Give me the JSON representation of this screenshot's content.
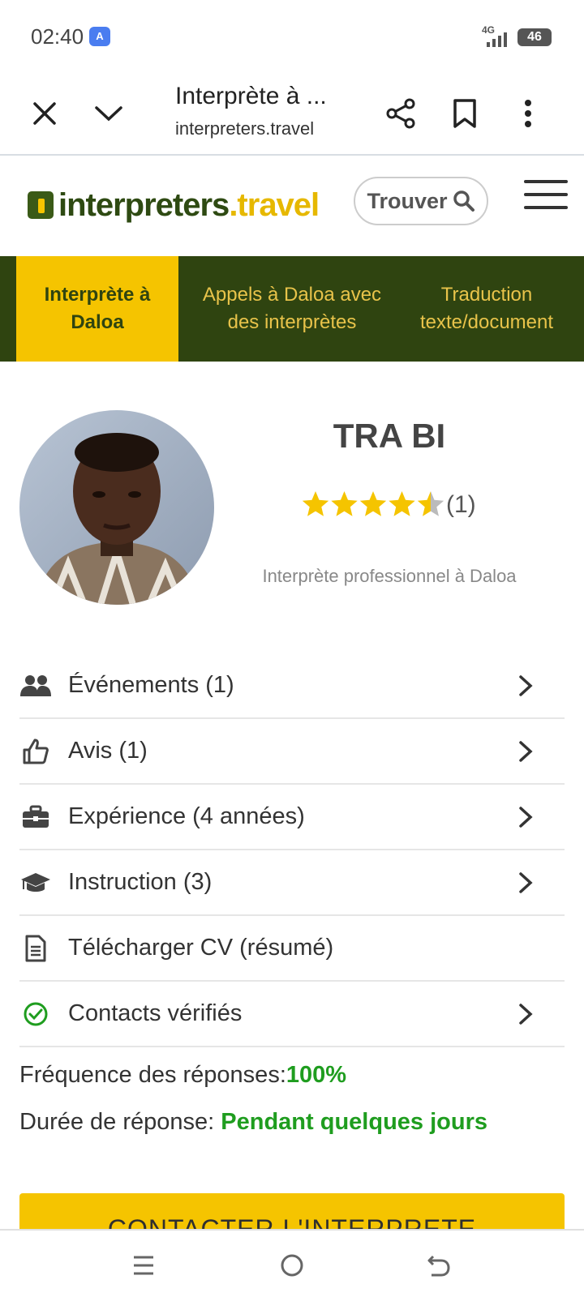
{
  "status_bar": {
    "time": "02:40",
    "translate_badge": "A",
    "network": "4G",
    "battery": "46"
  },
  "browser": {
    "tab_title": "Interprète à ...",
    "url": "interpreters.travel",
    "icons": [
      "close-icon",
      "chevron-down-icon",
      "share-icon",
      "bookmark-icon",
      "more-vert-icon"
    ]
  },
  "site": {
    "logo_main": "interpreters",
    "logo_tld": ".travel",
    "find_label": "Trouver"
  },
  "tabs": [
    {
      "label": "Interprète à Daloa",
      "active": true
    },
    {
      "label": "Appels à Daloa avec des interprètes",
      "active": false
    },
    {
      "label": "Traduction texte/document",
      "active": false
    }
  ],
  "profile": {
    "name": "TRA BI",
    "rating": 4.5,
    "rating_max": 5,
    "rating_count": "(1)",
    "subtitle": "Interprète professionnel à Daloa"
  },
  "menu": [
    {
      "icon": "users-icon",
      "label": "Événements (1)",
      "chevron": true
    },
    {
      "icon": "thumbs-up-icon",
      "label": "Avis (1)",
      "chevron": true
    },
    {
      "icon": "briefcase-icon",
      "label": "Expérience (4 années)",
      "chevron": true
    },
    {
      "icon": "graduation-cap-icon",
      "label": "Instruction (3)",
      "chevron": true
    },
    {
      "icon": "document-icon",
      "label": "Télécharger CV (résumé)",
      "chevron": false
    },
    {
      "icon": "check-circle-icon",
      "label": "Contacts vérifiés",
      "chevron": true
    }
  ],
  "stats": {
    "frequency_label": "Fréquence des réponses:",
    "frequency_value": "100%",
    "duration_label": "Durée de réponse: ",
    "duration_value": "Pendant quelques jours"
  },
  "cta_label": "CONTACTER L'INTERPRETE",
  "colors": {
    "brand_green": "#2f4410",
    "brand_yellow": "#f5c400",
    "success_green": "#1f9d1f",
    "star": "#f5c400"
  }
}
